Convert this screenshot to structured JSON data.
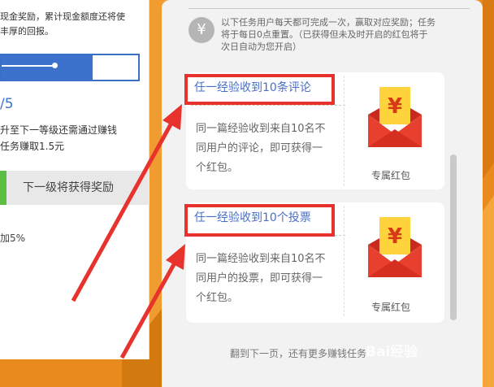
{
  "left_card": {
    "text_line1": "现金奖励，累计现金额度还将使",
    "text_line2": "丰厚的回报。",
    "level_text": "/5",
    "upgrade_line1": "升至下一等级还需通过赚钱",
    "upgrade_line2": "任务赚取1.5元",
    "next_level_tab": "下一级将获得奖励",
    "bonus_text": "加5%"
  },
  "notice": {
    "icon": "yen-icon",
    "line1": "以下任务用户每天都可完成一次，赢取对应奖励；任务",
    "line2": "将于每日0点重置。（已获得但未及时开启的红包将于",
    "line3": "次日自动为您开启）"
  },
  "tasks": [
    {
      "title": "任一经验收到10条评论",
      "desc_line1": "同一篇经验收到来自10名不",
      "desc_line2": "同用户的评论，即可获得一",
      "desc_line3": "个红包。",
      "reward_label": "专属红包"
    },
    {
      "title": "任一经验收到10个投票",
      "desc_line1": "同一篇经验收到来自10名不",
      "desc_line2": "同用户的投票，即可获得一",
      "desc_line3": "个红包。",
      "reward_label": "专属红包"
    }
  ],
  "footer": {
    "text": "翻到下一页，还有更多赚钱任务"
  },
  "watermark": {
    "text": "Bai经验"
  },
  "colors": {
    "background_orange": "#e98a1e",
    "highlight_red": "#e8322e",
    "link_blue": "#4a6fc9",
    "progress_blue": "#3d72cc",
    "tab_green": "#5cbf43"
  }
}
